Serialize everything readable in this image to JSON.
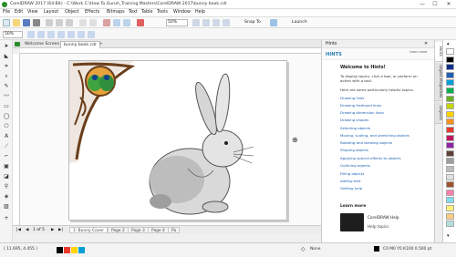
{
  "window": {
    "title": "CorelDRAW 2017 (64-Bit) - C:\\Work C:\\How To Guruh_Training Masters\\CorelDRAW 2017\\bunny book.cdr",
    "minimize": "—",
    "maximize": "☐",
    "close": "✕"
  },
  "menu": [
    "File",
    "Edit",
    "View",
    "Layout",
    "Object",
    "Effects",
    "Bitmaps",
    "Text",
    "Table",
    "Tools",
    "Window",
    "Help"
  ],
  "toolbar": {
    "zoom_value": "50%",
    "snap_label": "Snap To",
    "launch_label": "Launch"
  },
  "propbar": {
    "zoom_field": "50%"
  },
  "tabs": {
    "welcome": "Welcome Screen",
    "document": "bunny book.cdr",
    "add": "+"
  },
  "pages": {
    "counter": "1 of 5",
    "items": [
      "1: Bunny Cover",
      "Page 2",
      "Page 3",
      "Page 4",
      "Pa"
    ]
  },
  "hints": {
    "panel_title": "Hints",
    "header": "HINTS",
    "learn_more": "Learn more",
    "welcome_title": "Welcome to Hints!",
    "intro": "To display topics, click a tool, or perform an action with a tool.",
    "subhead": "Here are some particularly helpful topics:",
    "topics": [
      "Drawing lines",
      "Drawing freehand lines",
      "Drawing dimension lines",
      "Drawing shapes",
      "Selecting objects",
      "Moving, scaling, and stretching objects",
      "Rotating and skewing objects",
      "Shaping objects",
      "Applying special effects to objects",
      "Outlining objects",
      "Filling objects",
      "Adding text",
      "Getting help"
    ],
    "learn_more_footer": "Learn more",
    "help_title": "CorelDRAW Help",
    "help_topics": "Help topics"
  },
  "docker_tabs": [
    "Hints",
    "Object Properties",
    "Objects"
  ],
  "palette_colors": [
    "#ffffff",
    "#000000",
    "#0f2f8c",
    "#1f5fb4",
    "#00a0d6",
    "#00b050",
    "#6ab023",
    "#c8d400",
    "#ffd400",
    "#f7941d",
    "#e8392b",
    "#c2185b",
    "#8e24aa",
    "#5d4037",
    "#9e9e9e",
    "#bdbdbd",
    "#e0e0e0",
    "#a0522d",
    "#ff80ab",
    "#80deea",
    "#fff176",
    "#ffcc80",
    "#b2dfdb"
  ],
  "status": {
    "coords": "( 11.695, 4.455 )",
    "fill_label": "None",
    "color_info": "C0 M0 Y0 K100  0.500 pt"
  }
}
